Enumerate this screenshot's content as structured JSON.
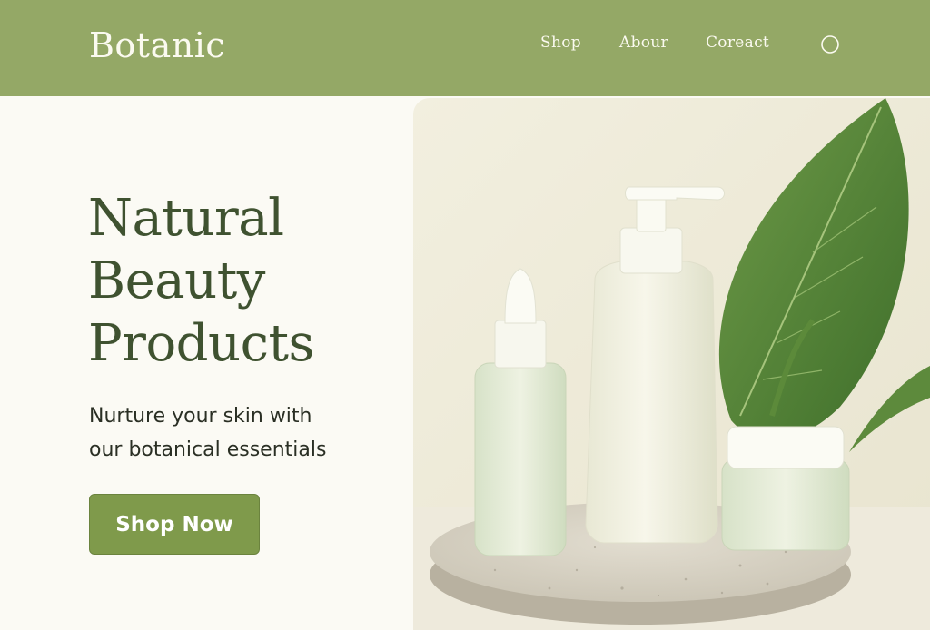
{
  "header": {
    "brand": "Botanic",
    "nav": [
      "Shop",
      "Abour",
      "Coreact"
    ],
    "search_icon": "search-icon",
    "background_color": "#94a866"
  },
  "hero": {
    "title_lines": [
      "Natural",
      "Beauty",
      "Products"
    ],
    "subtitle_lines": [
      "Nurture your skin with",
      "our botanical essentials"
    ],
    "cta_label": "Shop Now",
    "title_color": "#3f5230",
    "cta_color": "#7f9a4b"
  },
  "hero_image": {
    "subject": "product-photo",
    "items": [
      "dropper-bottle",
      "pump-bottle",
      "cream-jar",
      "stone-pedestal",
      "green-leaf"
    ]
  }
}
